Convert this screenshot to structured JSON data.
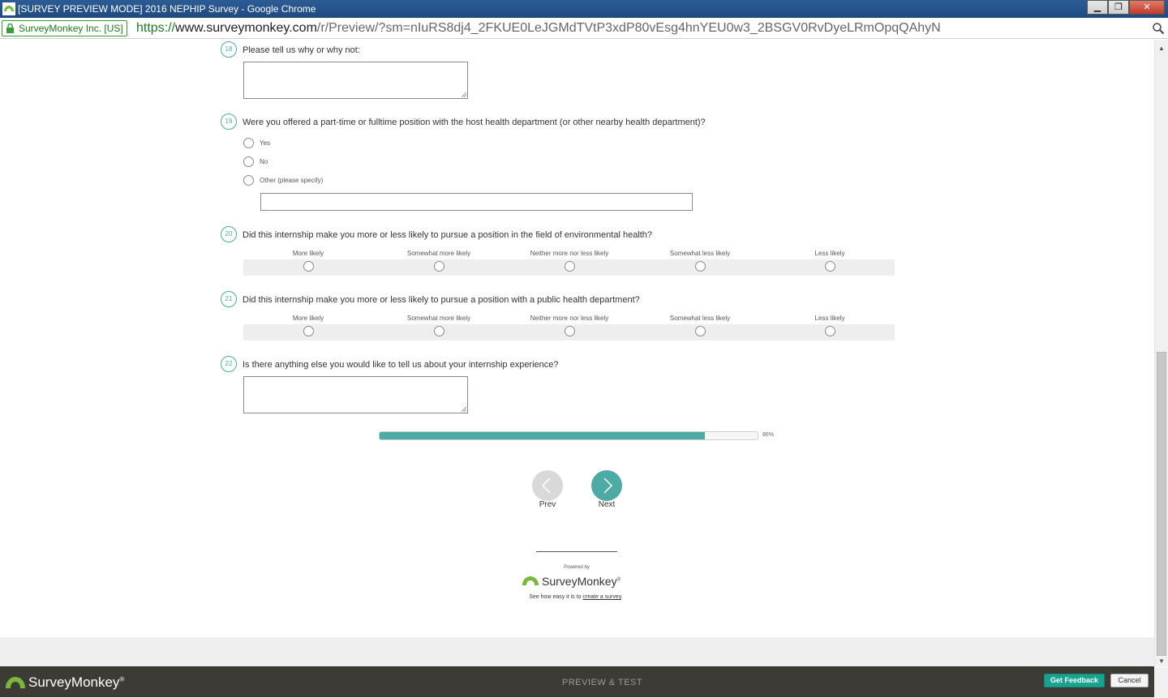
{
  "window": {
    "title": "[SURVEY PREVIEW MODE] 2016 NEPHIP Survey - Google Chrome",
    "minimize": "▁",
    "maximize": "❐",
    "close": "✕"
  },
  "address_bar": {
    "secure_label": "SurveyMonkey Inc. [US]",
    "scheme": "https://",
    "host": "www.surveymonkey.com",
    "path": "/r/Preview/?sm=nIuRS8dj4_2FKUE0LeJGMdTVtP3xdP80vEsg4hnYEU0w3_2BSGV0RvDyeLRmOpqQAhyN"
  },
  "questions": {
    "q18": {
      "number": "18",
      "text": "Please tell us why or why not:"
    },
    "q19": {
      "number": "19",
      "text": "Were you offered a part-time or fulltime position with the host health department (or other nearby health department)?",
      "options": [
        "Yes",
        "No",
        "Other (please specify)"
      ]
    },
    "q20": {
      "number": "20",
      "text": "Did this internship make you more or less likely to pursue a position in the field of environmental health?",
      "columns": [
        "More likely",
        "Somewhat more likely",
        "Neither more nor less likely",
        "Somewhat less likely",
        "Less likely"
      ]
    },
    "q21": {
      "number": "21",
      "text": "Did this internship make you more or less likely to pursue a position with a public health department?",
      "columns": [
        "More likely",
        "Somewhat more likely",
        "Neither more nor less likely",
        "Somewhat less likely",
        "Less likely"
      ]
    },
    "q22": {
      "number": "22",
      "text": "Is there anything else you would like to tell us about your internship experience?"
    }
  },
  "progress": {
    "percent": 86,
    "label": "86%"
  },
  "navigation": {
    "prev_label": "Prev",
    "next_label": "Next"
  },
  "footer": {
    "powered_by": "Powered by",
    "brand": "SurveyMonkey",
    "tagline_prefix": "See how easy it is to ",
    "tagline_link": "create a survey",
    "tagline_suffix": "."
  },
  "preview_bar": {
    "brand": "SurveyMonkey",
    "mode_label": "PREVIEW & TEST",
    "feedback_button": "Get Feedback",
    "cancel_button": "Cancel"
  },
  "colors": {
    "accent": "#4daaa5",
    "feedback": "#18a38e",
    "logo_green": "#7ab83a",
    "bar": "#3d3b35"
  },
  "icons": [
    "surveymonkey-icon",
    "lock-icon",
    "zoom-icon",
    "chevron-left-icon",
    "chevron-right-icon"
  ]
}
